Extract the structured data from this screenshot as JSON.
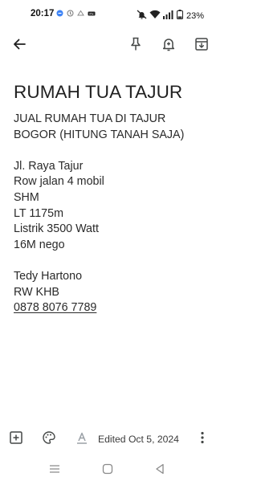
{
  "status_bar": {
    "time": "20:17",
    "battery_percent": "23%",
    "left_icons": [
      "app-notification-icon",
      "app-notification-icon",
      "app-notification-icon",
      "app-notification-icon"
    ],
    "right_icons": [
      "mute-icon",
      "wifi-icon",
      "signal-icon",
      "battery-icon"
    ]
  },
  "toolbar": {
    "icons": [
      "back-arrow-icon",
      "pin-icon",
      "reminder-bell-icon",
      "archive-icon"
    ]
  },
  "note": {
    "title": "RUMAH TUA TAJUR",
    "lines": [
      "JUAL RUMAH TUA DI TAJUR",
      "BOGOR (HITUNG TANAH SAJA)",
      "",
      "Jl. Raya Tajur",
      "Row jalan 4 mobil",
      "SHM",
      "LT 1175m",
      "Listrik 3500 Watt",
      "16M nego",
      "",
      "Tedy Hartono",
      "RW KHB",
      "0878 8076 7789"
    ]
  },
  "bottom_bar": {
    "edited_text": "Edited Oct 5, 2024",
    "icons": [
      "add-box-icon",
      "palette-icon",
      "text-format-icon",
      "more-vert-icon"
    ]
  },
  "nav_bar": {
    "icons": [
      "menu-icon",
      "home-icon",
      "back-icon"
    ]
  },
  "colors": {
    "background": "#ffffff",
    "text": "#1f1f1f",
    "icon": "#444746"
  }
}
